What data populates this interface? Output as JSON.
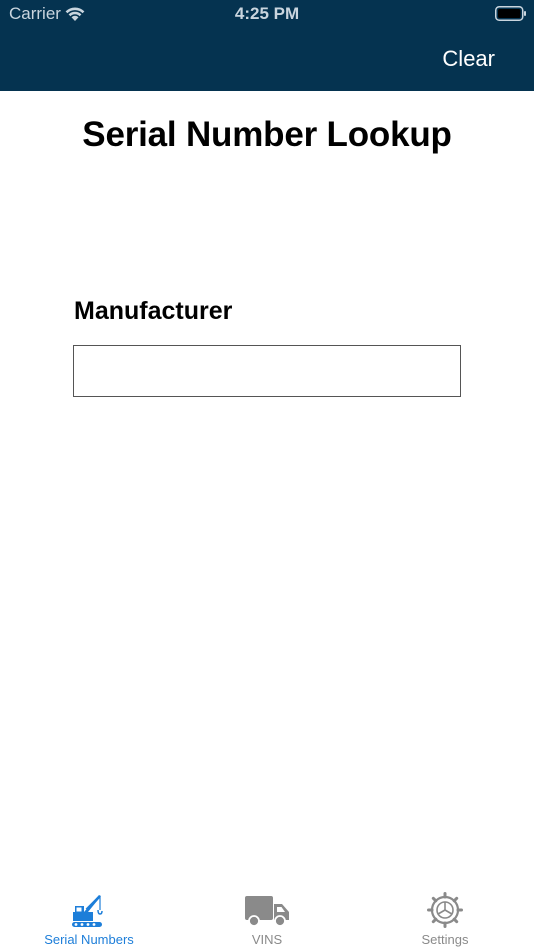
{
  "status_bar": {
    "carrier": "Carrier",
    "time": "4:25 PM"
  },
  "nav": {
    "clear_label": "Clear",
    "background_color": "#053350"
  },
  "main": {
    "title": "Serial Number Lookup",
    "manufacturer_label": "Manufacturer",
    "manufacturer_value": ""
  },
  "tabs": [
    {
      "label": "Serial Numbers",
      "icon": "crane-icon",
      "active": true
    },
    {
      "label": "VINS",
      "icon": "truck-icon",
      "active": false
    },
    {
      "label": "Settings",
      "icon": "gear-icon",
      "active": false
    }
  ],
  "colors": {
    "accent": "#1d7ed9",
    "inactive": "#8a8a8a"
  }
}
